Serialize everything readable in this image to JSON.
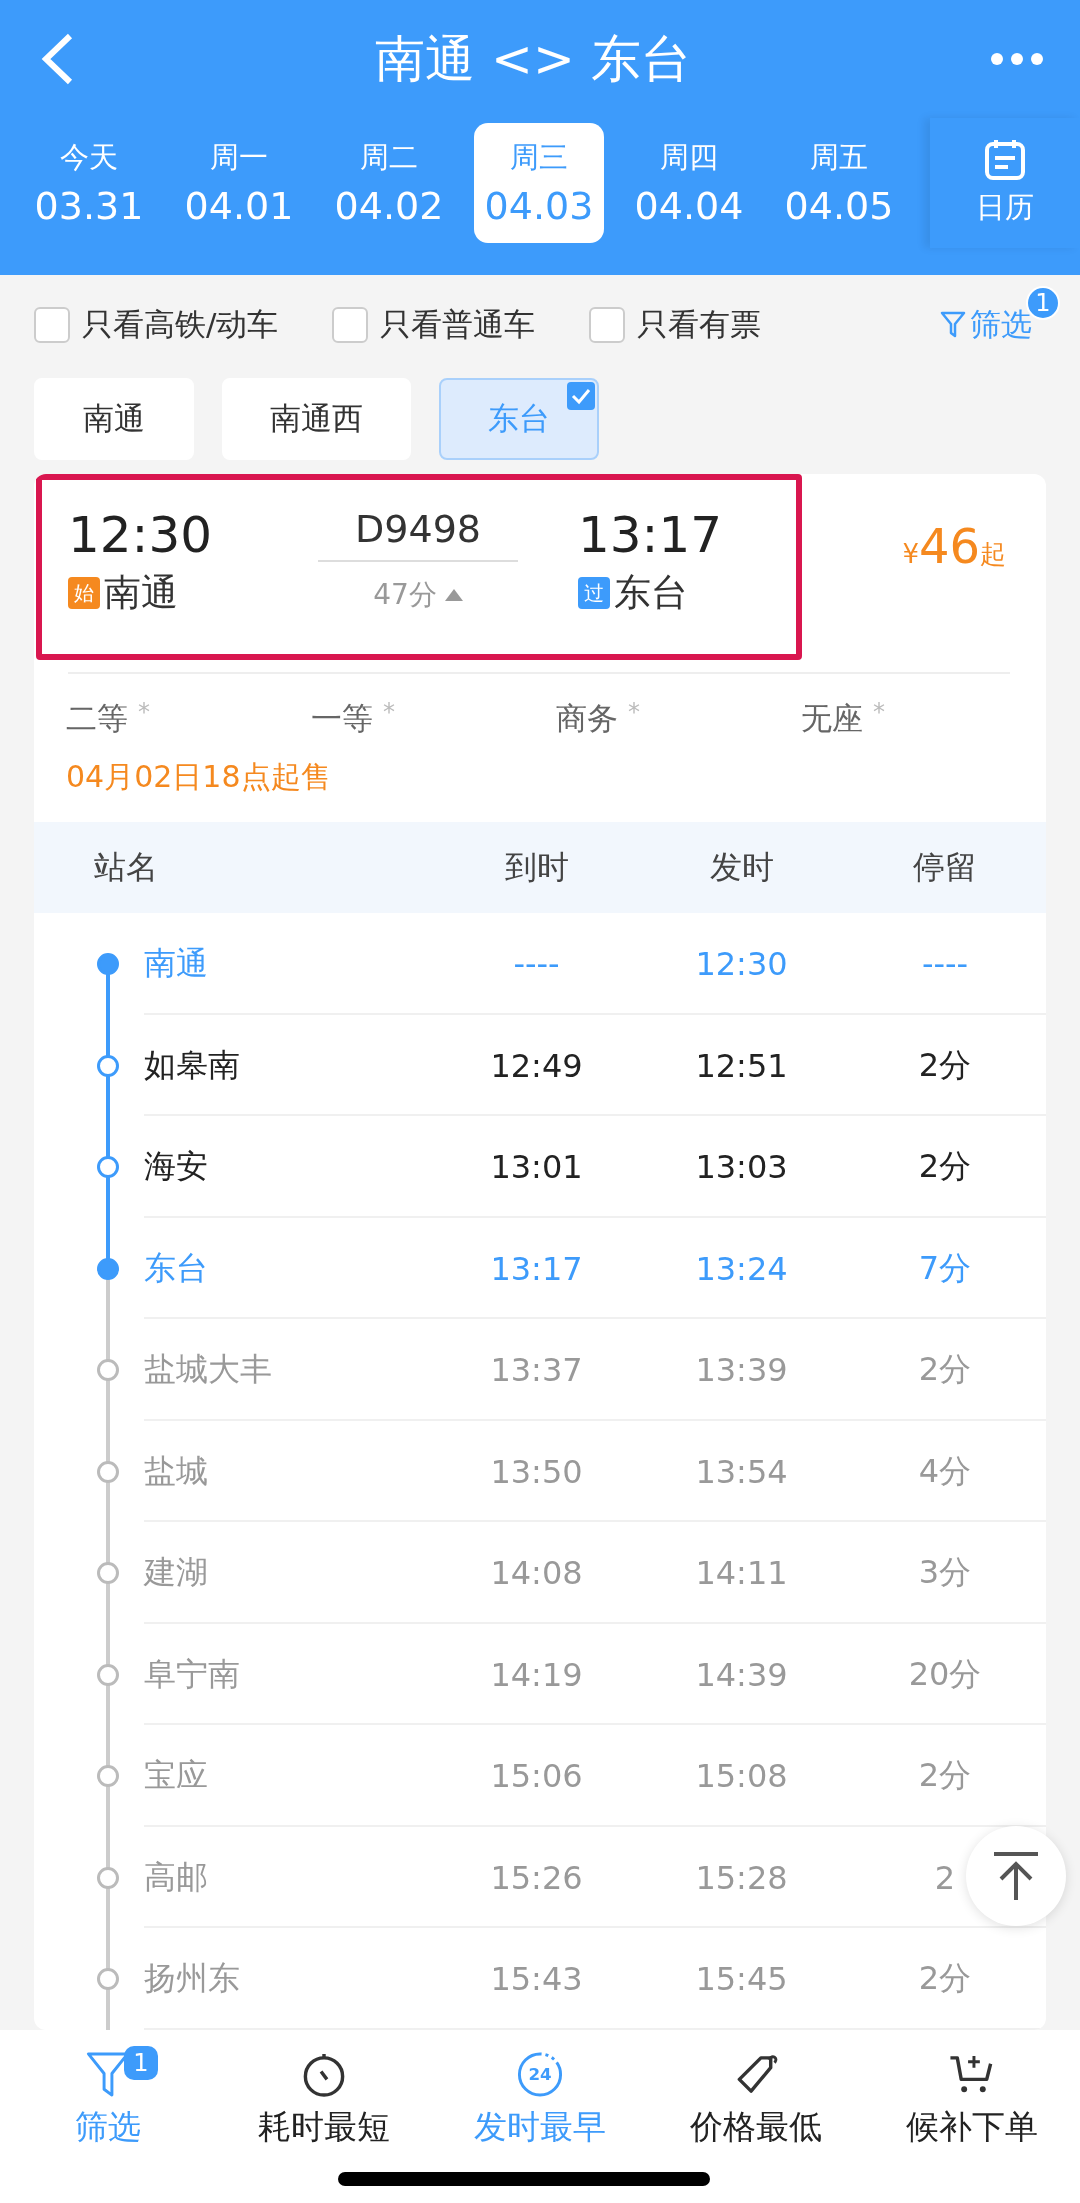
{
  "header": {
    "title": "南通 <> 东台"
  },
  "dates": [
    {
      "weekday": "今天",
      "date": "03.31",
      "selected": false
    },
    {
      "weekday": "周一",
      "date": "04.01",
      "selected": false
    },
    {
      "weekday": "周二",
      "date": "04.02",
      "selected": false
    },
    {
      "weekday": "周三",
      "date": "04.03",
      "selected": true
    },
    {
      "weekday": "周四",
      "date": "04.04",
      "selected": false
    },
    {
      "weekday": "周五",
      "date": "04.05",
      "selected": false
    }
  ],
  "calendar": {
    "label": "日历"
  },
  "quick_filters": [
    {
      "label": "只看高铁/动车",
      "checked": false
    },
    {
      "label": "只看普通车",
      "checked": false
    },
    {
      "label": "只看有票",
      "checked": false
    }
  ],
  "filter_link": {
    "label": "筛选",
    "badge": "1"
  },
  "station_chips": [
    {
      "label": "南通",
      "selected": false
    },
    {
      "label": "南通西",
      "selected": false
    },
    {
      "label": "东台",
      "selected": true
    }
  ],
  "train": {
    "depart_time": "12:30",
    "depart_tag": "始",
    "depart_station": "南通",
    "number": "D9498",
    "duration": "47分",
    "arrive_time": "13:17",
    "arrive_tag": "过",
    "arrive_station": "东台",
    "price_symbol": "¥",
    "price": "46",
    "price_suffix": "起"
  },
  "seats": [
    {
      "class": "二等",
      "mark": "*"
    },
    {
      "class": "一等",
      "mark": "*"
    },
    {
      "class": "商务",
      "mark": "*"
    },
    {
      "class": "无座",
      "mark": "*"
    }
  ],
  "sale_notice": "04月02日18点起售",
  "stops": {
    "columns": [
      "站名",
      "到时",
      "发时",
      "停留"
    ],
    "rows": [
      {
        "kind": "end",
        "station": "南通",
        "arrive": "----",
        "depart": "12:30",
        "stay": "----"
      },
      {
        "kind": "route",
        "station": "如皋南",
        "arrive": "12:49",
        "depart": "12:51",
        "stay": "2分"
      },
      {
        "kind": "route",
        "station": "海安",
        "arrive": "13:01",
        "depart": "13:03",
        "stay": "2分"
      },
      {
        "kind": "end",
        "station": "东台",
        "arrive": "13:17",
        "depart": "13:24",
        "stay": "7分"
      },
      {
        "kind": "other",
        "station": "盐城大丰",
        "arrive": "13:37",
        "depart": "13:39",
        "stay": "2分"
      },
      {
        "kind": "other",
        "station": "盐城",
        "arrive": "13:50",
        "depart": "13:54",
        "stay": "4分"
      },
      {
        "kind": "other",
        "station": "建湖",
        "arrive": "14:08",
        "depart": "14:11",
        "stay": "3分"
      },
      {
        "kind": "other",
        "station": "阜宁南",
        "arrive": "14:19",
        "depart": "14:39",
        "stay": "20分"
      },
      {
        "kind": "other",
        "station": "宝应",
        "arrive": "15:06",
        "depart": "15:08",
        "stay": "2分"
      },
      {
        "kind": "other",
        "station": "高邮",
        "arrive": "15:26",
        "depart": "15:28",
        "stay": "2"
      },
      {
        "kind": "other",
        "station": "扬州东",
        "arrive": "15:43",
        "depart": "15:45",
        "stay": "2分"
      }
    ]
  },
  "bottom_tabs": [
    {
      "kind": "filter",
      "label": "筛选",
      "badge": "1",
      "selected": true
    },
    {
      "kind": "timer",
      "label": "耗时最短",
      "selected": false
    },
    {
      "kind": "clock24",
      "label": "发时最早",
      "icon_text": "24",
      "selected": true
    },
    {
      "kind": "tag",
      "label": "价格最低",
      "selected": false
    },
    {
      "kind": "cart",
      "label": "候补下单",
      "selected": false
    }
  ]
}
